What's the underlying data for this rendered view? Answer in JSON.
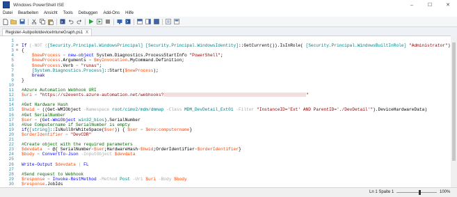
{
  "window": {
    "title": "Windows PowerShell ISE",
    "buttons": [
      "–",
      "☐",
      "✕"
    ]
  },
  "menu": [
    "Datei",
    "Bearbeiten",
    "Ansicht",
    "Tools",
    "Debuggen",
    "Add-Ons",
    "Hilfe"
  ],
  "tab": {
    "label": "Register-AutipoilotdeviceIntuneGraph.ps1",
    "close": "X"
  },
  "code_lines": [
    {
      "n": "1",
      "parts": []
    },
    {
      "n": "2",
      "fold": "⊟",
      "parts": [
        [
          "kw",
          "If "
        ],
        [
          "op",
          "("
        ],
        [
          "op",
          "-NOT "
        ],
        [
          "op",
          "("
        ],
        [
          "ty",
          "[Security.Principal.WindowsPrincipal]"
        ],
        [
          "mem",
          " "
        ],
        [
          "ty",
          "[Security.Principal.WindowsIdentity]"
        ],
        [
          "mem",
          "::GetCurrent()).IsInRole( "
        ],
        [
          "ty",
          "[Security.Principal.WindowsBuiltInRole]"
        ],
        [
          "mem",
          " "
        ],
        [
          "st",
          "\"Administrator\""
        ],
        [
          "mem",
          "))"
        ]
      ]
    },
    {
      "n": "3",
      "fold": "⊟",
      "parts": [
        [
          "mem",
          "{"
        ]
      ]
    },
    {
      "n": "4",
      "parts": [
        [
          "mem",
          "    "
        ],
        [
          "vr",
          "$newProcess"
        ],
        [
          "mem",
          " "
        ],
        [
          "op",
          "="
        ],
        [
          "mem",
          " "
        ],
        [
          "cmd",
          "new-object"
        ],
        [
          "mem",
          " System.Diagnostics.ProcessStartInfo "
        ],
        [
          "st",
          "\"PowerShell\""
        ],
        [
          "mem",
          ";"
        ]
      ]
    },
    {
      "n": "5",
      "parts": [
        [
          "mem",
          "    "
        ],
        [
          "vr",
          "$newProcess"
        ],
        [
          "mem",
          ".Arguments "
        ],
        [
          "op",
          "="
        ],
        [
          "mem",
          " "
        ],
        [
          "vr",
          "$myInvocation"
        ],
        [
          "mem",
          ".MyCommand.Definition;"
        ]
      ]
    },
    {
      "n": "6",
      "parts": [
        [
          "mem",
          "    "
        ],
        [
          "vr",
          "$newProcess"
        ],
        [
          "mem",
          ".Verb "
        ],
        [
          "op",
          "="
        ],
        [
          "mem",
          " "
        ],
        [
          "st",
          "\"runas\""
        ],
        [
          "mem",
          ";"
        ]
      ]
    },
    {
      "n": "7",
      "parts": [
        [
          "mem",
          "    "
        ],
        [
          "ty",
          "[System.Diagnostics.Process]"
        ],
        [
          "mem",
          "::Start("
        ],
        [
          "vr",
          "$newProcess"
        ],
        [
          "mem",
          ");"
        ]
      ]
    },
    {
      "n": "8",
      "parts": [
        [
          "mem",
          "    "
        ],
        [
          "kw",
          "break"
        ]
      ]
    },
    {
      "n": "9",
      "parts": [
        [
          "mem",
          "}"
        ]
      ]
    },
    {
      "n": "10",
      "parts": []
    },
    {
      "n": "11",
      "parts": [
        [
          "cm",
          "#Azure Automation Webhook URI"
        ]
      ]
    },
    {
      "n": "12",
      "parts": [
        [
          "vr",
          "$uri"
        ],
        [
          "mem",
          " "
        ],
        [
          "op",
          "="
        ],
        [
          "mem",
          " "
        ],
        [
          "st",
          "\"https://s2events.azure-automation.net/webhooks?"
        ],
        [
          "blur",
          ""
        ],
        [
          "st",
          "\""
        ]
      ]
    },
    {
      "n": "13",
      "parts": []
    },
    {
      "n": "14",
      "parts": [
        [
          "cm",
          "#Get Hardware Hash"
        ]
      ]
    },
    {
      "n": "15",
      "parts": [
        [
          "vr",
          "$hwid"
        ],
        [
          "mem",
          " "
        ],
        [
          "op",
          "="
        ],
        [
          "mem",
          " ((Get-WMIObject "
        ],
        [
          "op",
          "-Namespace"
        ],
        [
          "mem",
          " "
        ],
        [
          "ty",
          "root/cimv2/mdm/dmmap"
        ],
        [
          "mem",
          " "
        ],
        [
          "op",
          "-Class"
        ],
        [
          "mem",
          " "
        ],
        [
          "ty",
          "MDM_DevDetail_Ext01"
        ],
        [
          "mem",
          " "
        ],
        [
          "op",
          "-Filter"
        ],
        [
          "mem",
          " "
        ],
        [
          "st",
          "\"InstanceID='Ext' AND ParentID='./DevDetail'\""
        ],
        [
          "mem",
          ").DeviceHardwareData)"
        ]
      ]
    },
    {
      "n": "16",
      "parts": [
        [
          "cm",
          "#Get SerialNumber"
        ]
      ]
    },
    {
      "n": "17",
      "parts": [
        [
          "vr",
          "$ser"
        ],
        [
          "mem",
          " "
        ],
        [
          "op",
          "="
        ],
        [
          "mem",
          " ("
        ],
        [
          "cmd",
          "Get-WmiObject"
        ],
        [
          "mem",
          " "
        ],
        [
          "ty",
          "win32_bios"
        ],
        [
          "mem",
          ").SerialNumber"
        ]
      ]
    },
    {
      "n": "18",
      "parts": [
        [
          "cm",
          "#Use Computername if SerialNumber is empty"
        ]
      ]
    },
    {
      "n": "19",
      "parts": [
        [
          "kw",
          "if"
        ],
        [
          "mem",
          "("
        ],
        [
          "ty",
          "[string]"
        ],
        [
          "mem",
          "::IsNullOrWhiteSpace("
        ],
        [
          "vr",
          "$ser"
        ],
        [
          "mem",
          ")) { "
        ],
        [
          "vr",
          "$ser"
        ],
        [
          "mem",
          " "
        ],
        [
          "op",
          "="
        ],
        [
          "mem",
          " "
        ],
        [
          "vr",
          "$env:computername"
        ],
        [
          "mem",
          "}"
        ]
      ]
    },
    {
      "n": "20",
      "parts": [
        [
          "vr",
          "$orderIdentifier"
        ],
        [
          "mem",
          " "
        ],
        [
          "op",
          "="
        ],
        [
          "mem",
          " "
        ],
        [
          "st",
          "\"DevCDR\""
        ]
      ]
    },
    {
      "n": "21",
      "parts": []
    },
    {
      "n": "22",
      "parts": [
        [
          "cm",
          "#Create object with the required parameters"
        ]
      ]
    },
    {
      "n": "23",
      "parts": [
        [
          "vr",
          "$devdata"
        ],
        [
          "mem",
          "  "
        ],
        [
          "op",
          "="
        ],
        [
          "mem",
          " @{ SerialNumber"
        ],
        [
          "op",
          "="
        ],
        [
          "vr",
          "$ser"
        ],
        [
          "mem",
          ";HardwareHash"
        ],
        [
          "op",
          "="
        ],
        [
          "vr",
          "$hwid"
        ],
        [
          "mem",
          ";OrderIdentifier"
        ],
        [
          "op",
          "="
        ],
        [
          "vr",
          "$orderIdentifier"
        ],
        [
          "mem",
          "}"
        ]
      ]
    },
    {
      "n": "24",
      "parts": [
        [
          "vr",
          "$body"
        ],
        [
          "mem",
          " "
        ],
        [
          "op",
          "="
        ],
        [
          "mem",
          " "
        ],
        [
          "cmd",
          "ConvertTo-Json"
        ],
        [
          "mem",
          " "
        ],
        [
          "op",
          "-InputObject"
        ],
        [
          "mem",
          " "
        ],
        [
          "vr",
          "$devdata"
        ]
      ]
    },
    {
      "n": "25",
      "parts": []
    },
    {
      "n": "26",
      "parts": [
        [
          "cmd",
          "Write-Output"
        ],
        [
          "mem",
          " "
        ],
        [
          "vr",
          "$devdata"
        ],
        [
          "mem",
          " "
        ],
        [
          "op",
          "|"
        ],
        [
          "mem",
          " "
        ],
        [
          "cmd",
          "FL"
        ]
      ]
    },
    {
      "n": "27",
      "parts": []
    },
    {
      "n": "28",
      "parts": [
        [
          "cm",
          "#Send request to Webhook"
        ]
      ]
    },
    {
      "n": "29",
      "parts": [
        [
          "vr",
          "$response"
        ],
        [
          "mem",
          " "
        ],
        [
          "op",
          "="
        ],
        [
          "mem",
          " "
        ],
        [
          "cmd",
          "Invoke-RestMethod"
        ],
        [
          "mem",
          " "
        ],
        [
          "op",
          "-Method"
        ],
        [
          "mem",
          " "
        ],
        [
          "ty",
          "Post"
        ],
        [
          "mem",
          " "
        ],
        [
          "op",
          "-Uri"
        ],
        [
          "mem",
          " "
        ],
        [
          "vr",
          "$uri"
        ],
        [
          "mem",
          " "
        ],
        [
          "op",
          "-Body"
        ],
        [
          "mem",
          " "
        ],
        [
          "vr",
          "$body"
        ]
      ]
    },
    {
      "n": "30",
      "parts": [
        [
          "vr",
          "$response"
        ],
        [
          "mem",
          ".JobIds"
        ]
      ]
    }
  ],
  "status": {
    "position": "Ln 1  Spalte 1",
    "zoom": "100%"
  },
  "colors": {
    "keyword": "#00008b",
    "type": "#008080",
    "string": "#8b0000",
    "variable": "#ff4500",
    "comment": "#006400"
  }
}
